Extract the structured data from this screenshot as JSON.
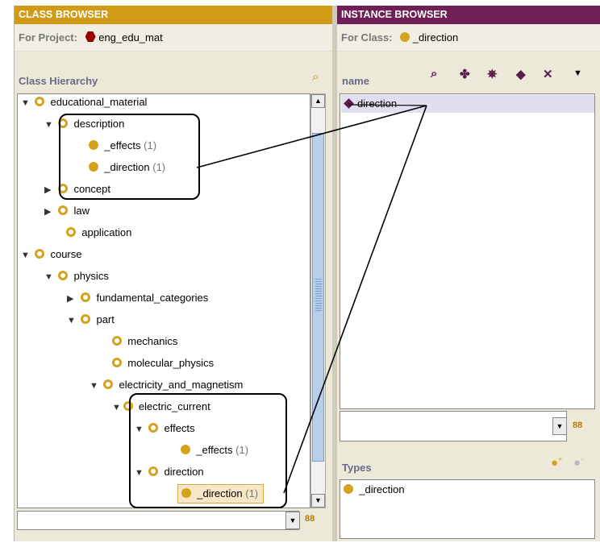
{
  "class_browser": {
    "title": "CLASS BROWSER",
    "for_label": "For Project:",
    "project": "eng_edu_mat",
    "hierarchy_label": "Class Hierarchy",
    "tree": [
      {
        "label": "educational_material",
        "count": "",
        "toggle": "▼",
        "icon": "open-class"
      },
      {
        "label": "description",
        "count": "",
        "toggle": "▼",
        "icon": "open-class"
      },
      {
        "label": "_effects",
        "count": "(1)",
        "toggle": "",
        "icon": "class"
      },
      {
        "label": "_direction",
        "count": "(1)",
        "toggle": "",
        "icon": "class"
      },
      {
        "label": "concept",
        "count": "",
        "toggle": "▶",
        "icon": "open-class"
      },
      {
        "label": "law",
        "count": "",
        "toggle": "▶",
        "icon": "open-class"
      },
      {
        "label": "application",
        "count": "",
        "toggle": "",
        "icon": "open-class"
      },
      {
        "label": "course",
        "count": "",
        "toggle": "▼",
        "icon": "open-class"
      },
      {
        "label": "physics",
        "count": "",
        "toggle": "▼",
        "icon": "open-class"
      },
      {
        "label": "fundamental_categories",
        "count": "",
        "toggle": "▶",
        "icon": "open-class"
      },
      {
        "label": "part",
        "count": "",
        "toggle": "▼",
        "icon": "open-class"
      },
      {
        "label": "mechanics",
        "count": "",
        "toggle": "",
        "icon": "open-class"
      },
      {
        "label": "molecular_physics",
        "count": "",
        "toggle": "",
        "icon": "open-class"
      },
      {
        "label": "electricity_and_magnetism",
        "count": "",
        "toggle": "▼",
        "icon": "open-class"
      },
      {
        "label": "electric_current",
        "count": "",
        "toggle": "▼",
        "icon": "open-class"
      },
      {
        "label": "effects",
        "count": "",
        "toggle": "▼",
        "icon": "open-class"
      },
      {
        "label": "_effects",
        "count": "(1)",
        "toggle": "",
        "icon": "class"
      },
      {
        "label": "direction",
        "count": "",
        "toggle": "▼",
        "icon": "open-class"
      },
      {
        "label": "_direction",
        "count": "(1)",
        "toggle": "",
        "icon": "class",
        "selected": true
      }
    ]
  },
  "instance_browser": {
    "title": "INSTANCE BROWSER",
    "for_label": "For Class:",
    "class_name": "_direction",
    "column_header": "name",
    "instances": [
      "direction"
    ],
    "types_label": "Types",
    "types": [
      "_direction"
    ]
  },
  "icons": {
    "search": "binoculars-icon",
    "toolbar": [
      "find-instance-icon",
      "create-instance-icon",
      "delete-instance-icon",
      "properties-icon",
      "remove-icon",
      "menu-down-icon"
    ]
  },
  "colors": {
    "class_header": "#d19b17",
    "instance_header": "#6e1f55",
    "class_icon": "#d4a21c",
    "project_icon": "#990000"
  }
}
